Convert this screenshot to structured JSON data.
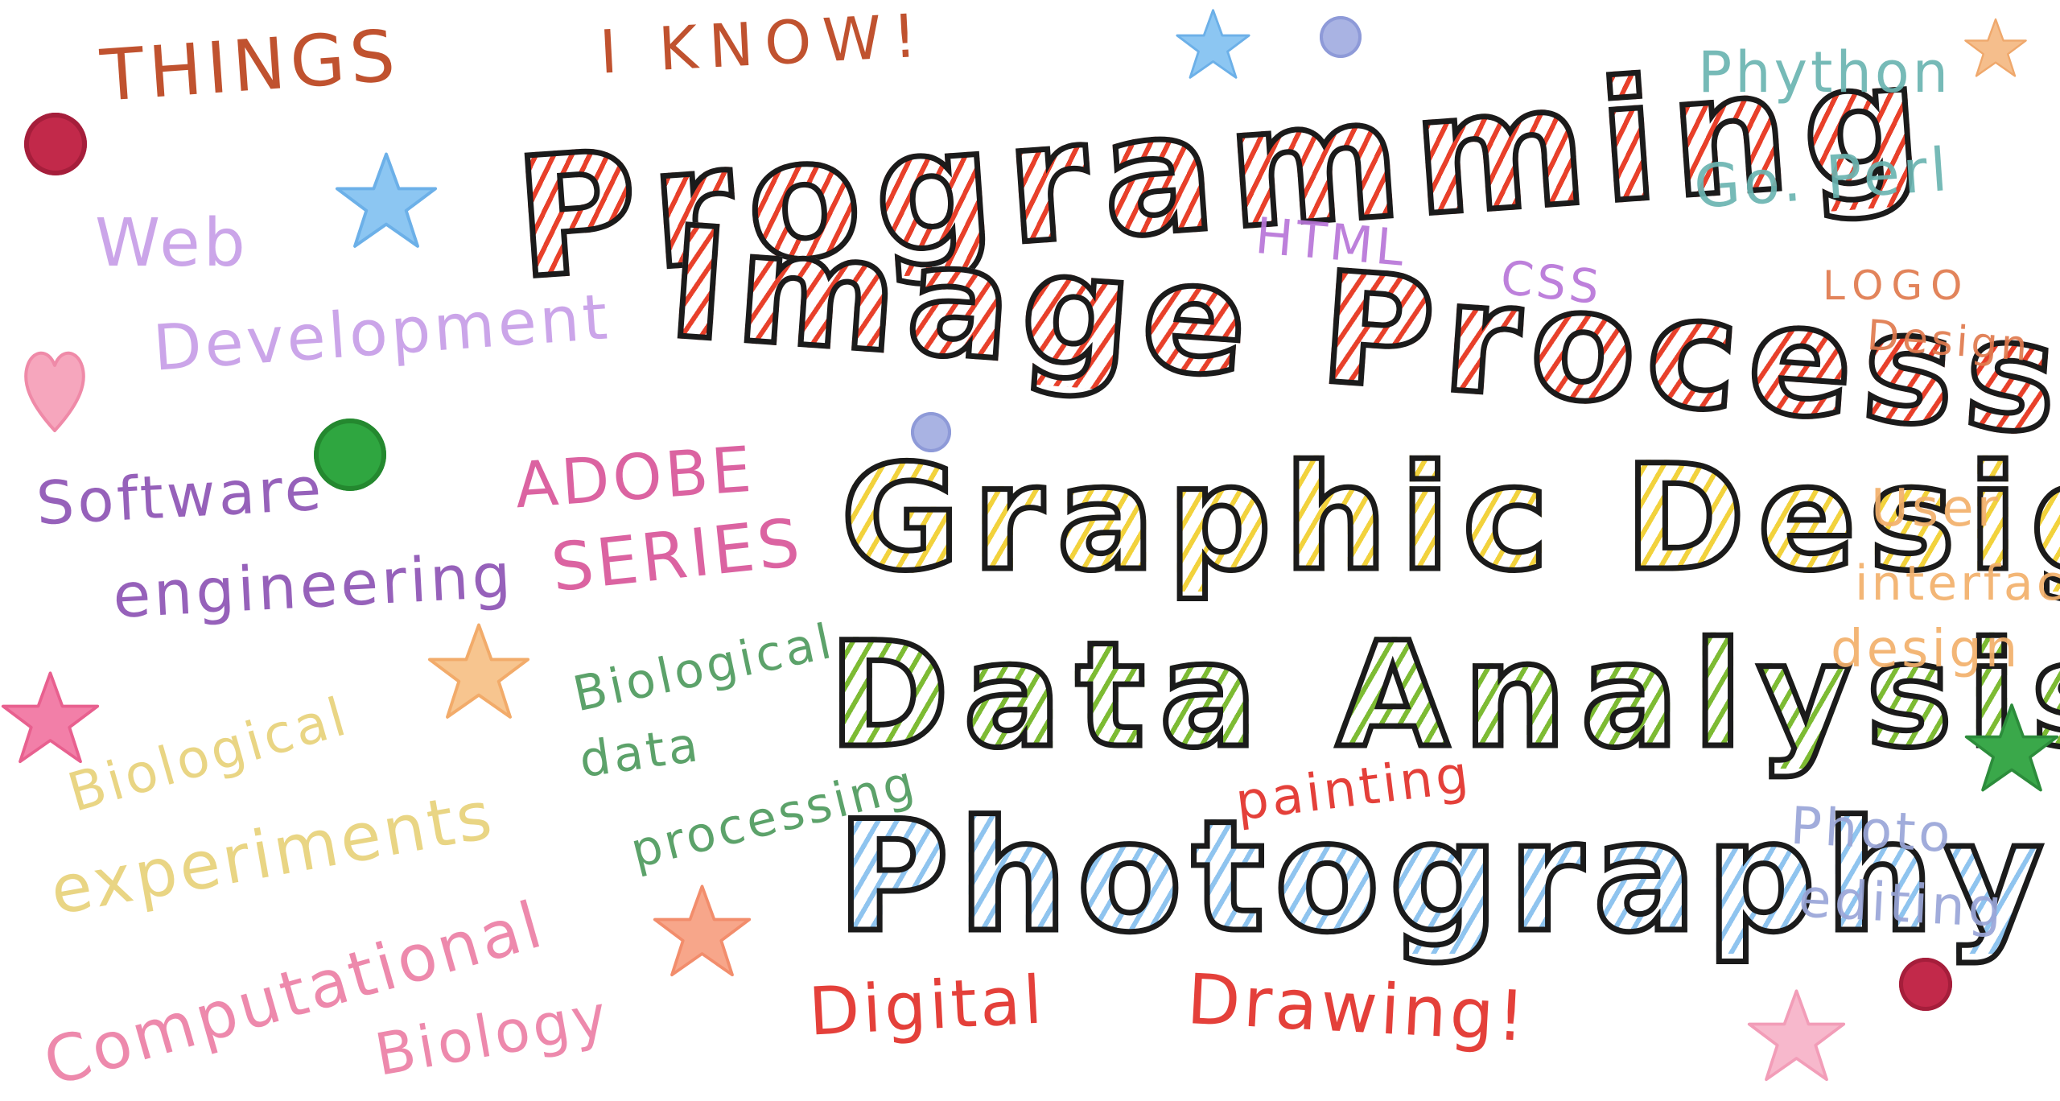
{
  "heading": {
    "line1": "THINGS",
    "line2": "I KNOW!",
    "color": "#c0522f"
  },
  "big_words": {
    "programming": "Programming",
    "image_processing": "Image Processing",
    "graphic_design": "Graphic Design",
    "data_analysis": "Data Analysis",
    "photography": "Photography"
  },
  "left_words": {
    "web": "Web",
    "development": "Development",
    "software": "Software",
    "engineering": "engineering",
    "biological": "Biological",
    "experiments": "experiments",
    "computational": "Computational",
    "biology": "Biology"
  },
  "middle_words": {
    "adobe": "ADOBE",
    "series": "SERIES",
    "bio_data_1": "Biological",
    "bio_data_2": "data",
    "bio_data_3": "processing",
    "html": "HTML",
    "css": "CSS",
    "painting": "painting",
    "digital": "Digital",
    "drawing": "Drawing!"
  },
  "right_words": {
    "phython": "Phython",
    "go_perl": "Go. Perl",
    "logo": "LOGO",
    "design": "Design",
    "user": "User",
    "interface": "interface",
    "design2": "design",
    "photo": "Photo",
    "editing": "editing"
  },
  "colors": {
    "red_fill": "#e8402a",
    "yellow_fill": "#f2d23c",
    "green_fill": "#7dbb33",
    "blue_fill": "#8fc4ef",
    "outline": "#1b1b1b"
  },
  "icons": {
    "stars": [
      "star-icon"
    ],
    "dots": [
      "dot-icon"
    ],
    "heart": "heart-icon"
  }
}
